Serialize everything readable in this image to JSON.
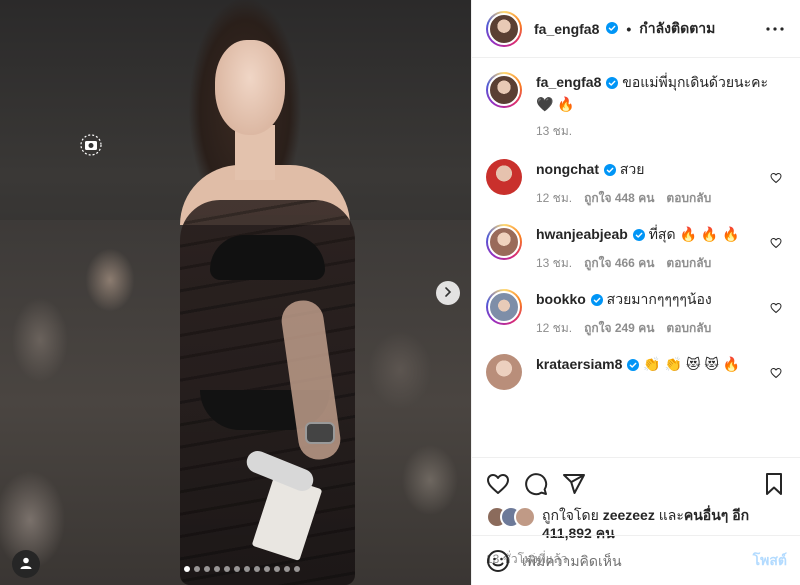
{
  "header": {
    "username": "fa_engfa8",
    "separator": "•",
    "follow_label": "กำลังติดตาม"
  },
  "caption": {
    "username": "fa_engfa8",
    "text": "ขอแม่พี่มุกเดินด้วยนะคะ 🖤 🔥",
    "time": "13 ชม."
  },
  "comments": [
    {
      "username": "nongchat",
      "text": "สวย",
      "time": "12 ชม.",
      "likes": "ถูกใจ 448 คน",
      "reply": "ตอบกลับ",
      "avatar_color": "#c9302c"
    },
    {
      "username": "hwanjeabjeab",
      "text": "ที่สุด 🔥 🔥 🔥",
      "time": "13 ชม.",
      "likes": "ถูกใจ 466 คน",
      "reply": "ตอบกลับ",
      "avatar_color": "#9a6b5a"
    },
    {
      "username": "bookko",
      "text": "สวยมากๆๆๆๆน้อง",
      "time": "12 ชม.",
      "likes": "ถูกใจ 249 คน",
      "reply": "ตอบกลับ",
      "avatar_color": "#7e8ea8"
    },
    {
      "username": "krataersiam8",
      "text": "👏 👏 😻 😻 🔥",
      "time": "",
      "likes": "",
      "reply": "",
      "avatar_color": "#b98e7a"
    }
  ],
  "likes": {
    "prefix": "ถูกใจโดย ",
    "user": "zeezeez",
    "middle": " และ",
    "others": "คนอื่นๆ อีก",
    "count": "411,892 คน"
  },
  "time_ago": "13 ชั่วโมงที่แล้ว",
  "add_comment": {
    "placeholder": "เพิ่มความคิดเห็น",
    "post_label": "โพสต์"
  },
  "colors": {
    "verified": "#0095f6",
    "text": "#262626",
    "muted": "#8e8e8e",
    "post_disabled": "#b3dbff"
  },
  "icons": [
    "camera-icon",
    "chevron-right-icon",
    "user-icon",
    "more-icon",
    "verified-icon",
    "heart-icon",
    "comment-icon",
    "share-icon",
    "bookmark-icon",
    "emoji-icon"
  ]
}
